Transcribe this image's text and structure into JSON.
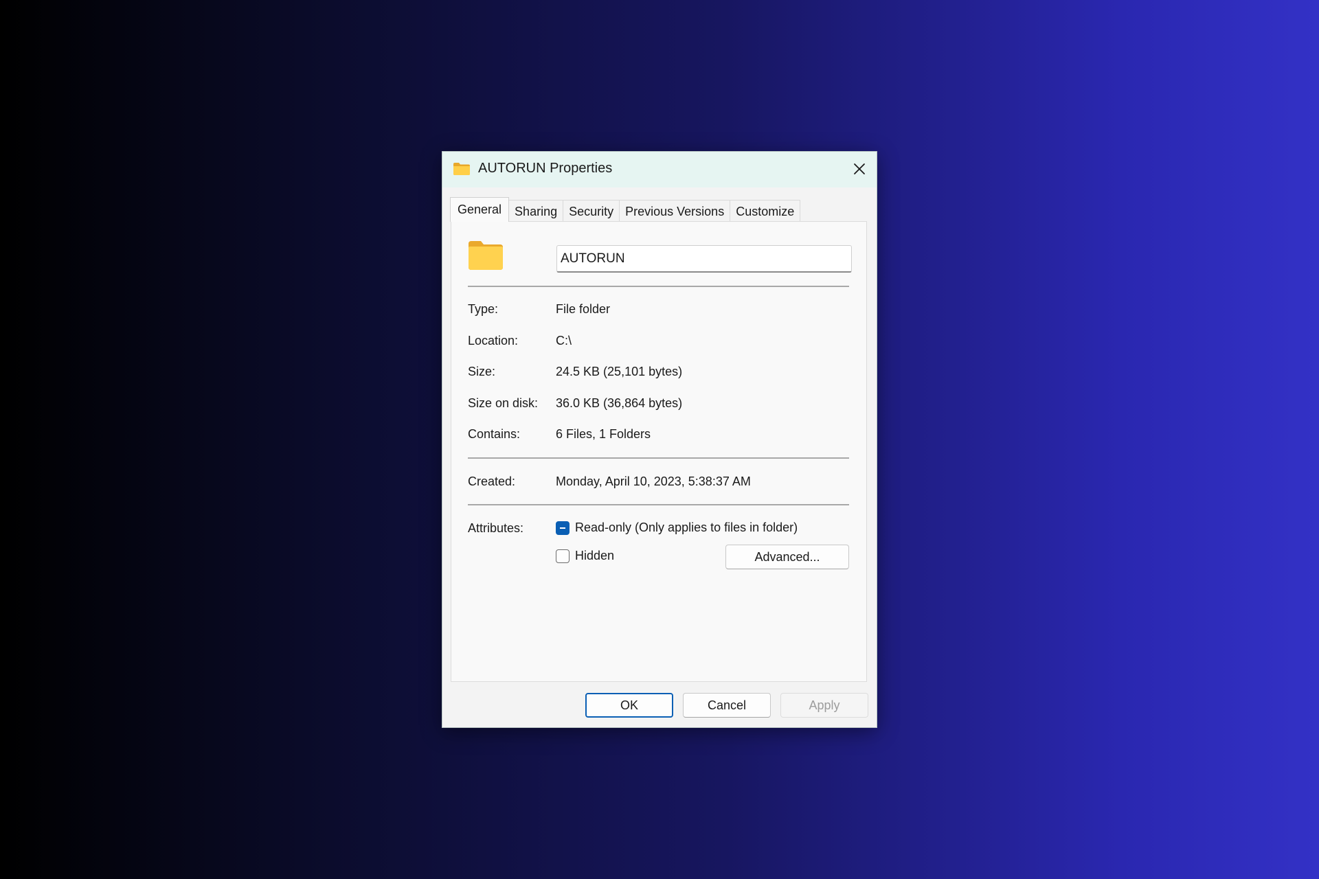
{
  "dialog": {
    "title": "AUTORUN Properties",
    "title_icon": "folder-icon",
    "close_icon": "close-icon"
  },
  "tabs": [
    {
      "label": "General",
      "active": true
    },
    {
      "label": "Sharing",
      "active": false
    },
    {
      "label": "Security",
      "active": false
    },
    {
      "label": "Previous Versions",
      "active": false
    },
    {
      "label": "Customize",
      "active": false
    }
  ],
  "general": {
    "folder_icon": "folder-icon",
    "name_value": "AUTORUN",
    "properties": {
      "type_label": "Type:",
      "type_value": "File folder",
      "location_label": "Location:",
      "location_value": "C:\\",
      "size_label": "Size:",
      "size_value": "24.5 KB (25,101 bytes)",
      "size_on_disk_label": "Size on disk:",
      "size_on_disk_value": "36.0 KB (36,864 bytes)",
      "contains_label": "Contains:",
      "contains_value": "6 Files, 1 Folders",
      "created_label": "Created:",
      "created_value": "Monday, April 10, 2023, 5:38:37 AM"
    },
    "attributes": {
      "label": "Attributes:",
      "readonly_label": "Read-only (Only applies to files in folder)",
      "readonly_state": "indeterminate",
      "hidden_label": "Hidden",
      "hidden_state": "unchecked",
      "advanced_label": "Advanced..."
    }
  },
  "buttons": {
    "ok": "OK",
    "cancel": "Cancel",
    "apply": "Apply",
    "apply_enabled": false
  },
  "colors": {
    "accent": "#0a5fb4",
    "folder": "#ffcf48",
    "titlebar": "#e6f5f2"
  }
}
